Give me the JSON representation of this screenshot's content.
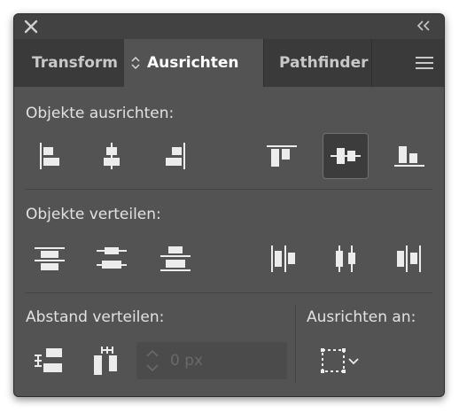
{
  "panel": {
    "tabs": [
      {
        "label": "Transform"
      },
      {
        "label": "Ausrichten"
      },
      {
        "label": "Pathfinder"
      }
    ]
  },
  "align_objects": {
    "label": "Objekte ausrichten:",
    "buttons": [
      {
        "icon": "align-left-icon"
      },
      {
        "icon": "align-horizontal-center-icon"
      },
      {
        "icon": "align-right-icon"
      },
      {
        "icon": "align-top-icon"
      },
      {
        "icon": "align-vertical-center-icon",
        "active": true
      },
      {
        "icon": "align-bottom-icon"
      }
    ]
  },
  "distribute_objects": {
    "label": "Objekte verteilen:",
    "buttons": [
      {
        "icon": "distribute-top-icon"
      },
      {
        "icon": "distribute-vertical-center-icon"
      },
      {
        "icon": "distribute-bottom-icon"
      },
      {
        "icon": "distribute-left-icon"
      },
      {
        "icon": "distribute-horizontal-center-icon"
      },
      {
        "icon": "distribute-right-icon"
      }
    ]
  },
  "distribute_spacing": {
    "label": "Abstand verteilen:",
    "spacing_placeholder": "0 px"
  },
  "align_to": {
    "label": "Ausrichten an:",
    "icon": "align-to-selection-icon"
  },
  "colors": {
    "panel_bg": "#535353",
    "tab_bar_bg": "#3a3a3a",
    "title_bar_bg": "#424242",
    "icon_fill": "#ececec",
    "text": "#e2e2e2"
  }
}
